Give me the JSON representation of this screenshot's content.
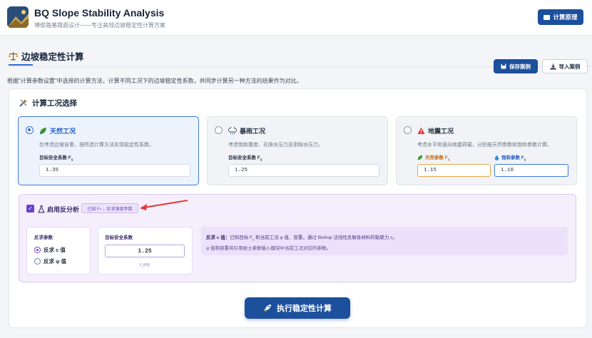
{
  "header": {
    "title": "BQ Slope Stability Analysis",
    "subtitle": "博俊路基路面设计——专注高效边坡稳定性计算方案",
    "principle_button": "计算原理"
  },
  "section": {
    "title": "边坡稳定性计算",
    "save_button": "保存案例",
    "import_button": "导入案例",
    "description": "根据\"计算参数设置\"中选择的计算方法，计算不同工况下的边坡稳定性系数，并同步计算另一种方法的结果作为对比。"
  },
  "conditions": {
    "title": "计算工况选择",
    "options": [
      {
        "title": "天然工况",
        "desc": "仅考虑边坡自重，按所选计算方法实现稳定性系数。",
        "label": "目标安全系数 F",
        "label_sub": "s",
        "value": "1.35",
        "selected": true
      },
      {
        "title": "暴雨工况",
        "desc": "考虑饱和重度、孔隙水压力及割隙水压力。",
        "label": "目标安全系数 F",
        "label_sub": "s",
        "value": "1.25",
        "selected": false
      },
      {
        "title": "地震工况",
        "desc": "考虑水平和竖向地震荷载，分别按天然参数和饱和参数计算。",
        "natural_label": "天然参数 F",
        "natural_sub": "s",
        "natural_value": "1.15",
        "saturated_label": "饱和参数 F",
        "saturated_sub": "s",
        "saturated_value": "1.10",
        "selected": false
      }
    ]
  },
  "inverse": {
    "checkbox_checked": true,
    "title": "启用反分析",
    "badge": "已知 F",
    "badge_sub": "s",
    "badge_rest": " → 反求强度参数",
    "params_label": "反求参数",
    "opt_c": "反求 c 值",
    "opt_phi": "反求 φ 值",
    "selected": "c",
    "target_label": "目标安全系数",
    "target_value": "1.25",
    "target_hint": "F",
    "target_hint_sub": "s",
    "target_hint_rest": "目标",
    "info_bold": "反求 c 值：",
    "info_line1": "已知目标 F",
    "info_line1_sub": "s",
    "info_line1_rest": " 和当前工况 φ 值、容重，通过 Bishop 法线性反解各材料的黏聚力 c。",
    "info_line2": "φ 值和容重将引用岩土参数输入模块中当前工况对应的参数。"
  },
  "run_button": "执行稳定性计算",
  "colors": {
    "primary": "#1c4f9c",
    "accent_blue": "#2e6ad1",
    "purple": "#6e3fd1",
    "arrow_red": "#e5383b"
  }
}
